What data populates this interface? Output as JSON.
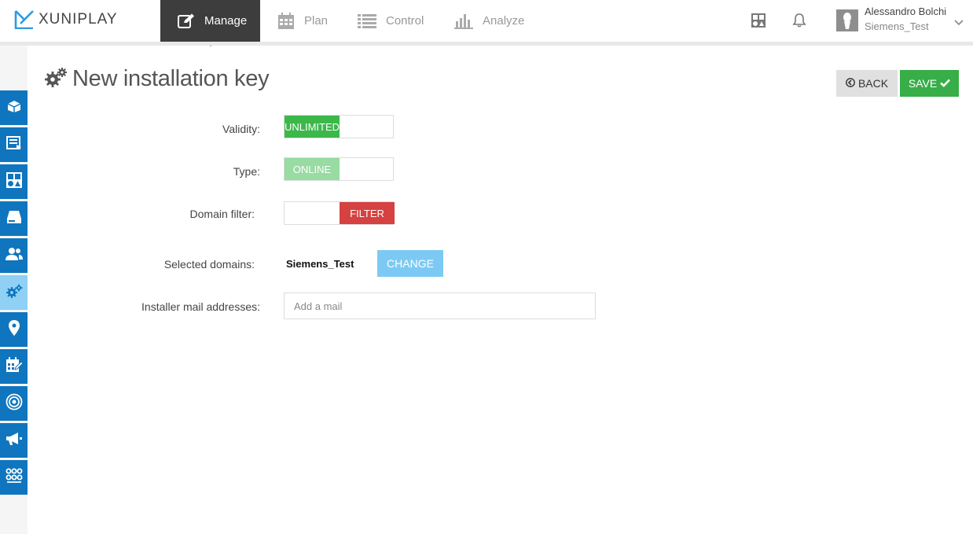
{
  "app": {
    "logo_text": "XUNIPLAY"
  },
  "nav": {
    "items": [
      {
        "label": "Manage",
        "icon": "edit-icon",
        "active": true
      },
      {
        "label": "Plan",
        "icon": "calendar-icon",
        "active": false
      },
      {
        "label": "Control",
        "icon": "list-icon",
        "active": false
      },
      {
        "label": "Analyze",
        "icon": "bar-chart-icon",
        "active": false
      }
    ]
  },
  "user": {
    "name": "Alessandro Bolchi",
    "domain": "Siemens_Test"
  },
  "sidebar": {
    "items": [
      {
        "icon": "cube-icon",
        "active": false
      },
      {
        "icon": "playlist-icon",
        "active": false
      },
      {
        "icon": "layout-icon",
        "active": false
      },
      {
        "icon": "hard-drive-icon",
        "active": false
      },
      {
        "icon": "users-icon",
        "active": false
      },
      {
        "icon": "gears-icon",
        "active": true
      },
      {
        "icon": "map-marker-icon",
        "active": false
      },
      {
        "icon": "calendar-edit-icon",
        "active": false
      },
      {
        "icon": "broadcast-icon",
        "active": false
      },
      {
        "icon": "megaphone-icon",
        "active": false
      },
      {
        "icon": "network-icon",
        "active": false
      }
    ]
  },
  "page": {
    "title": "New installation key",
    "back_label": "BACK",
    "save_label": "SAVE"
  },
  "form": {
    "validity_label": "Validity:",
    "validity_value": "UNLIMITED",
    "type_label": "Type:",
    "type_value": "ONLINE",
    "domain_filter_label": "Domain filter:",
    "domain_filter_value": "FILTER",
    "selected_domains_label": "Selected domains:",
    "selected_domains_value": "Siemens_Test",
    "change_label": "CHANGE",
    "mail_label": "Installer mail addresses:",
    "mail_placeholder": "Add a mail",
    "mail_value": ""
  },
  "colors": {
    "accent_blue": "#0f75be",
    "sidebar_active": "#8fd0f4",
    "nav_active": "#3d3d3d",
    "save_green": "#37ae48",
    "unlimited_green": "#3cb84b",
    "online_green_light": "#98dba3",
    "filter_red": "#d64141",
    "change_blue": "#7ccaf3"
  }
}
